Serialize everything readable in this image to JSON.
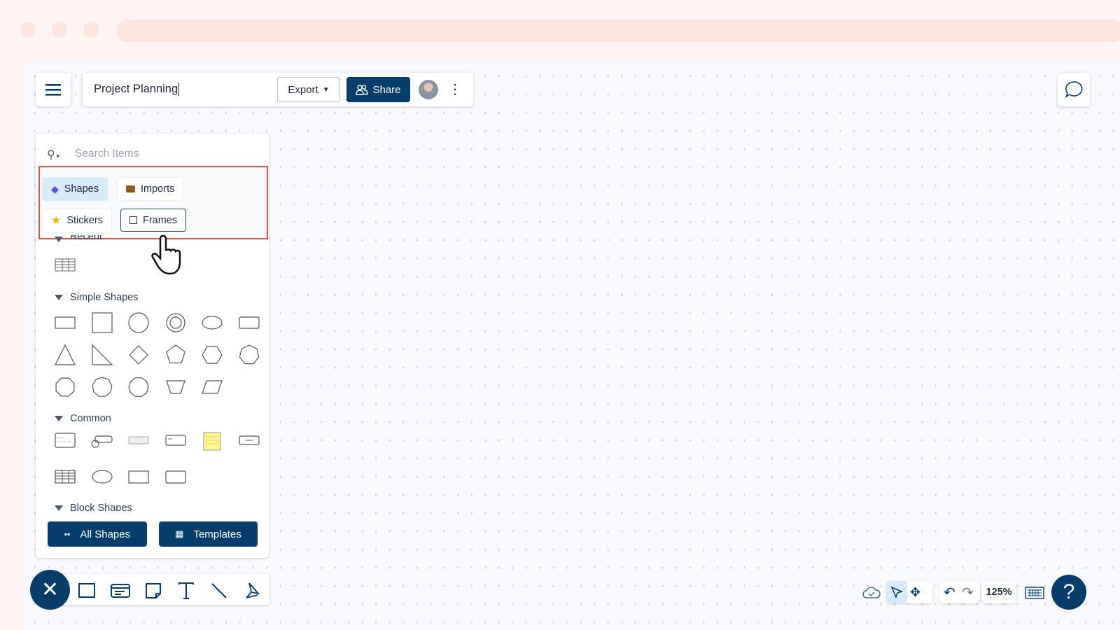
{
  "header": {
    "title": "Project Planning",
    "export_label": "Export",
    "share_label": "Share"
  },
  "search": {
    "placeholder": "Search Items"
  },
  "tabs": [
    {
      "label": "Shapes",
      "icon": "diamond-icon",
      "active": true
    },
    {
      "label": "Imports",
      "icon": "briefcase-icon"
    },
    {
      "label": "Stickers",
      "icon": "star-icon"
    },
    {
      "label": "Frames",
      "icon": "frame-icon",
      "hovered": true
    }
  ],
  "sections": {
    "recent": "Recent",
    "simple": "Simple Shapes",
    "common": "Common",
    "block": "Block Shapes"
  },
  "footer": {
    "all_shapes": "All Shapes",
    "templates": "Templates"
  },
  "zoom": {
    "level": "125%"
  },
  "colors": {
    "primary": "#053d6b",
    "highlight": "#d9534f",
    "active_bg": "#d6eaf8",
    "sticky": "#fbf58a"
  }
}
